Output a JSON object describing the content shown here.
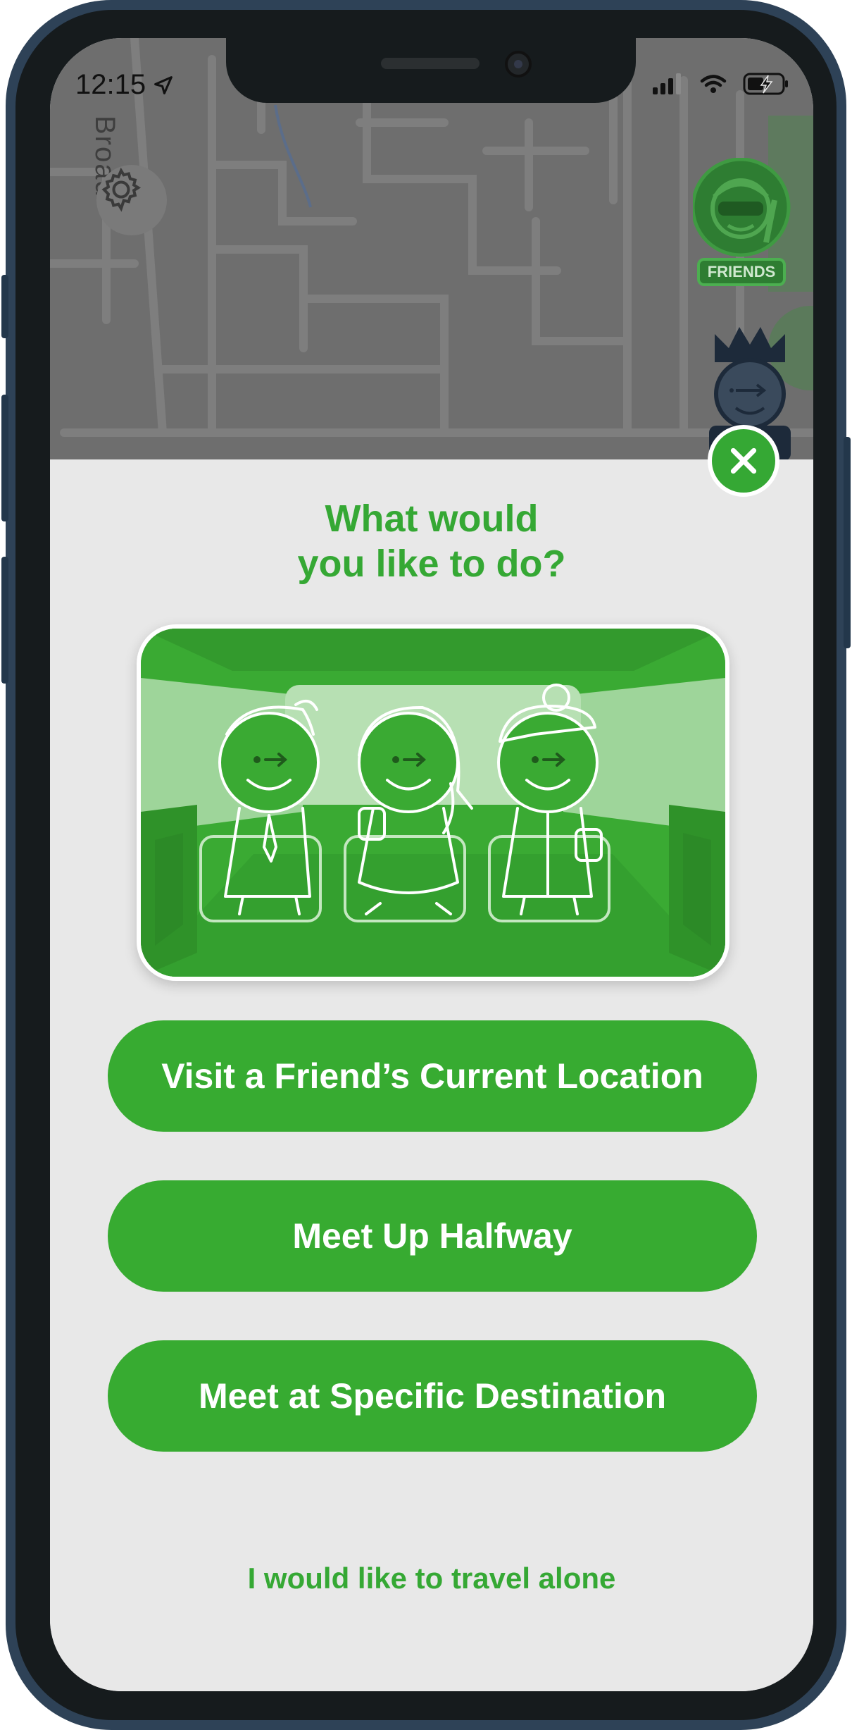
{
  "status_bar": {
    "time": "12:15",
    "icons": [
      "location-arrow-icon",
      "signal-icon",
      "wifi-icon",
      "battery-charging-icon"
    ]
  },
  "map": {
    "road_label": "Broad",
    "settings_icon": "gear-icon"
  },
  "friends_button": {
    "label": "FRIENDS"
  },
  "sheet": {
    "close_icon": "close-icon",
    "prompt": "What would\nyou like to do?",
    "options": [
      "Visit a Friend’s Current Location",
      "Meet Up Halfway",
      "Meet at Specific Destination"
    ],
    "alone_link": "I would like to travel alone"
  },
  "colors": {
    "brand_green": "#35a834",
    "sheet_bg": "#e8e8e8",
    "map_dim": "#6e6e6e"
  }
}
